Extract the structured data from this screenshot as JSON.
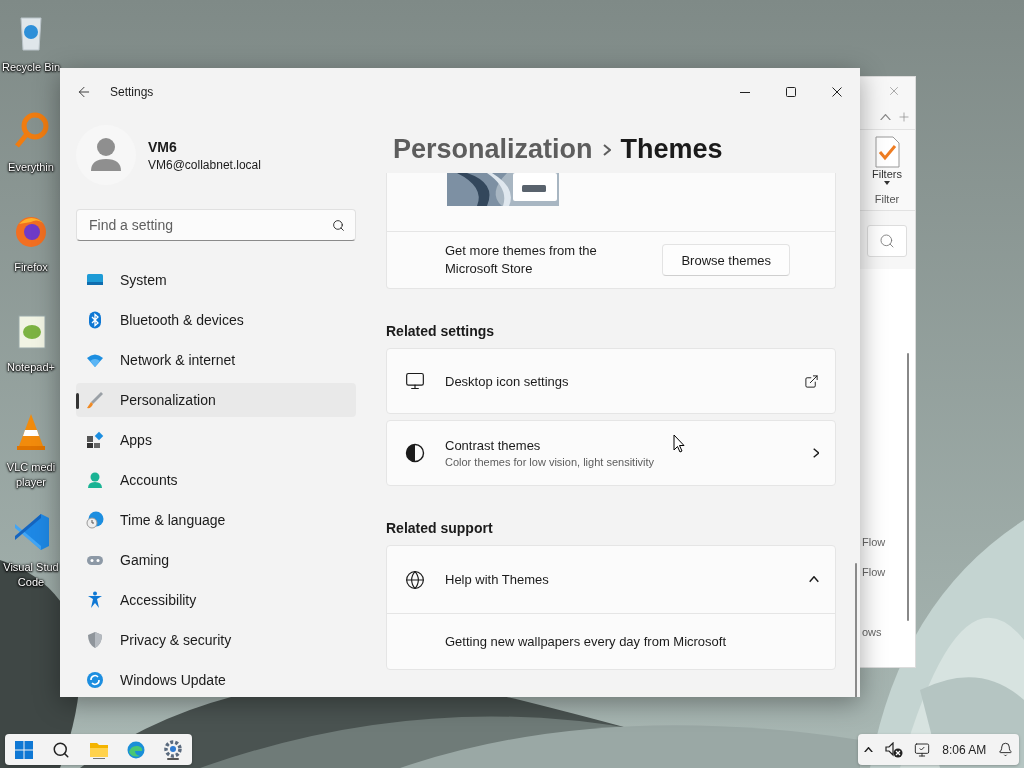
{
  "desktop_icons": [
    {
      "label_lines": [
        "Recycle Bin"
      ]
    },
    {
      "label_lines": [
        "Everythin"
      ]
    },
    {
      "label_lines": [
        "Firefox"
      ]
    },
    {
      "label_lines": [
        "Notepad+"
      ]
    },
    {
      "label_lines": [
        "VLC medi",
        "player"
      ]
    },
    {
      "label_lines": [
        "Visual Stud",
        "Code"
      ]
    }
  ],
  "background_window": {
    "ribbon_label": "Filters",
    "group_label": "Filter",
    "list_items": [
      "Flow",
      "Flow",
      "ows"
    ]
  },
  "settings": {
    "title": "Settings",
    "user": {
      "name": "VM6",
      "email": "VM6@collabnet.local"
    },
    "search": {
      "placeholder": "Find a setting"
    },
    "nav": [
      {
        "label": "System",
        "selected": false
      },
      {
        "label": "Bluetooth & devices",
        "selected": false
      },
      {
        "label": "Network & internet",
        "selected": false
      },
      {
        "label": "Personalization",
        "selected": true
      },
      {
        "label": "Apps",
        "selected": false
      },
      {
        "label": "Accounts",
        "selected": false
      },
      {
        "label": "Time & language",
        "selected": false
      },
      {
        "label": "Gaming",
        "selected": false
      },
      {
        "label": "Accessibility",
        "selected": false
      },
      {
        "label": "Privacy & security",
        "selected": false
      },
      {
        "label": "Windows Update",
        "selected": false
      }
    ],
    "breadcrumb": [
      "Personalization",
      "Themes"
    ],
    "theme_store": {
      "text": "Get more themes from the Microsoft Store",
      "button": "Browse themes"
    },
    "sections": [
      {
        "title": "Related settings",
        "rows": [
          {
            "kind": "link",
            "title": "Desktop icon settings"
          },
          {
            "kind": "nav",
            "title": "Contrast themes",
            "subtitle": "Color themes for low vision, light sensitivity"
          }
        ]
      },
      {
        "title": "Related support",
        "rows": [
          {
            "kind": "expander",
            "title": "Help with Themes",
            "expanded": true,
            "children": [
              "Getting new wallpapers every day from Microsoft"
            ]
          }
        ]
      }
    ]
  },
  "taskbar": {
    "time": "8:06 AM"
  }
}
